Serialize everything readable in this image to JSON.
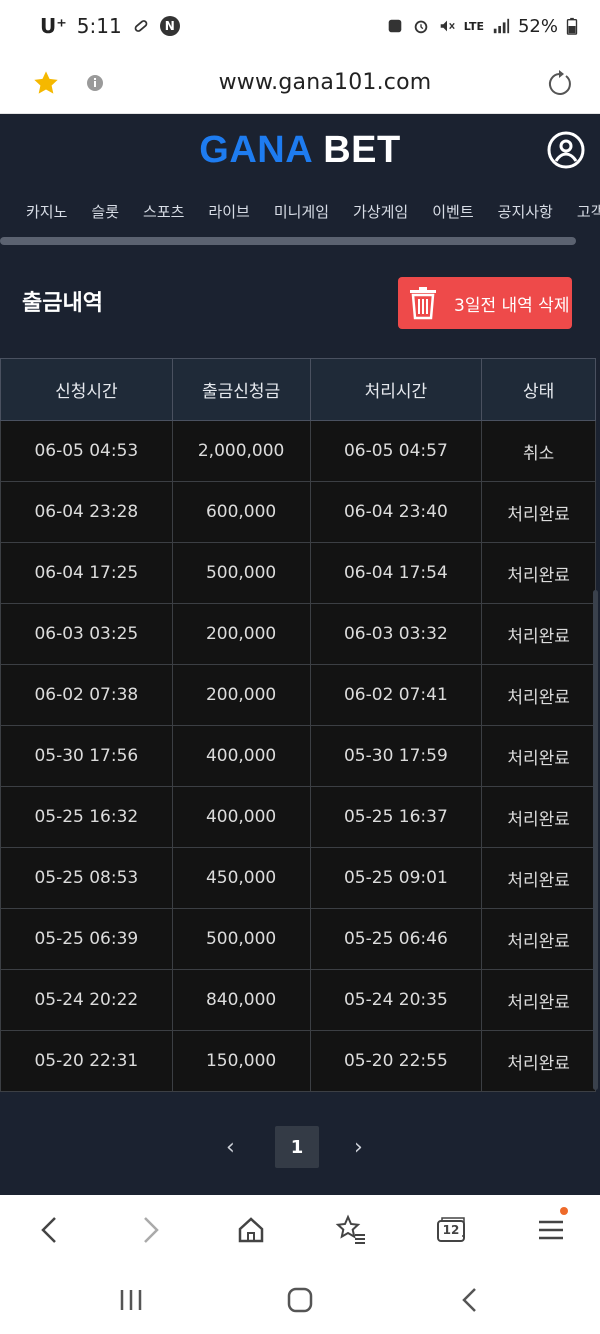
{
  "status_bar": {
    "carrier": "U⁺",
    "time": "5:11",
    "network": "LTE",
    "battery": "52%"
  },
  "browser": {
    "url": "www.gana101.com"
  },
  "site": {
    "logo_part1": "GANA",
    "logo_part2": "BET"
  },
  "nav": {
    "items": [
      "카지노",
      "슬롯",
      "스포츠",
      "라이브",
      "미니게임",
      "가상게임",
      "이벤트",
      "공지사항",
      "고객센터"
    ]
  },
  "section": {
    "title": "출금내역",
    "delete_label": "3일전 내역 삭제"
  },
  "table": {
    "headers": [
      "신청시간",
      "출금신청금",
      "처리시간",
      "상태"
    ],
    "rows": [
      [
        "06-05 04:53",
        "2,000,000",
        "06-05 04:57",
        "취소"
      ],
      [
        "06-04 23:28",
        "600,000",
        "06-04 23:40",
        "처리완료"
      ],
      [
        "06-04 17:25",
        "500,000",
        "06-04 17:54",
        "처리완료"
      ],
      [
        "06-03 03:25",
        "200,000",
        "06-03 03:32",
        "처리완료"
      ],
      [
        "06-02 07:38",
        "200,000",
        "06-02 07:41",
        "처리완료"
      ],
      [
        "05-30 17:56",
        "400,000",
        "05-30 17:59",
        "처리완료"
      ],
      [
        "05-25 16:32",
        "400,000",
        "05-25 16:37",
        "처리완료"
      ],
      [
        "05-25 08:53",
        "450,000",
        "05-25 09:01",
        "처리완료"
      ],
      [
        "05-25 06:39",
        "500,000",
        "05-25 06:46",
        "처리완료"
      ],
      [
        "05-24 20:22",
        "840,000",
        "05-24 20:35",
        "처리완료"
      ],
      [
        "05-20 22:31",
        "150,000",
        "05-20 22:55",
        "처리완료"
      ]
    ]
  },
  "pagination": {
    "prev": "‹",
    "current": "1",
    "next": "›"
  },
  "toolbar": {
    "tab_count": "12"
  },
  "colors": {
    "background": "#1b2230",
    "brand_blue": "#1e7cf0",
    "delete_red": "#ee4a4a",
    "row_bg": "#131313"
  }
}
